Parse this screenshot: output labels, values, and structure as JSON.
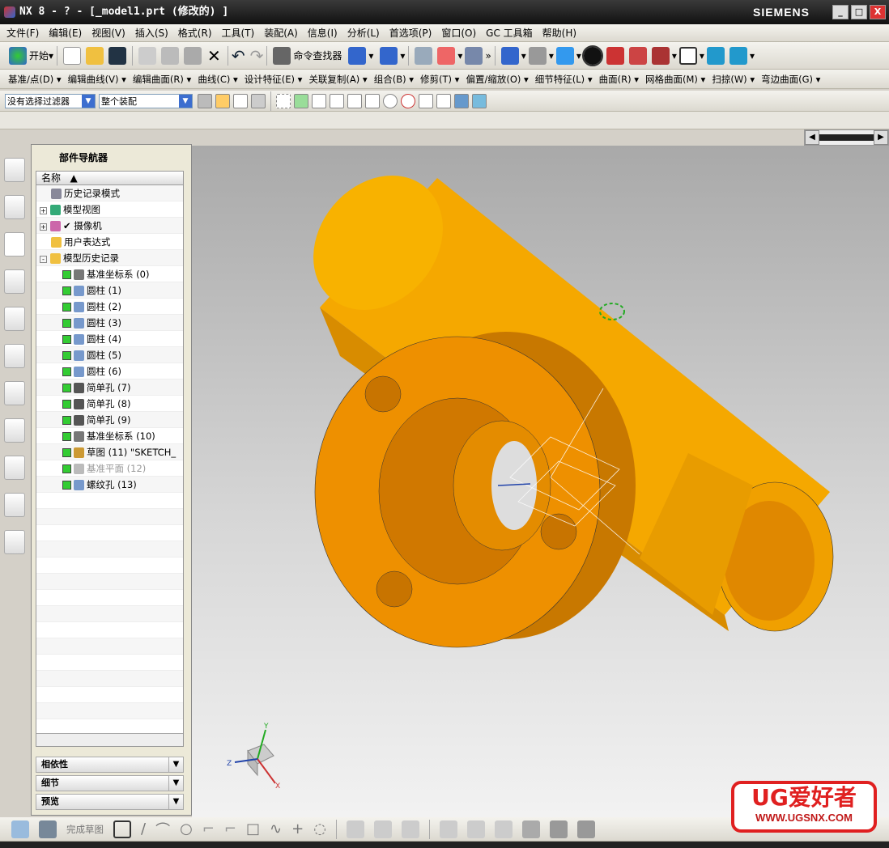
{
  "window": {
    "title": "NX 8 - ? - [_model1.prt (修改的) ]",
    "brand": "SIEMENS",
    "min": "_",
    "max": "□",
    "close": "X"
  },
  "menu": [
    "文件(F)",
    "编辑(E)",
    "视图(V)",
    "插入(S)",
    "格式(R)",
    "工具(T)",
    "装配(A)",
    "信息(I)",
    "分析(L)",
    "首选项(P)",
    "窗口(O)",
    "GC 工具箱",
    "帮助(H)"
  ],
  "toolbar": {
    "start": "开始",
    "command_finder": "命令查找器"
  },
  "feature_toolbar": [
    "基准/点(D) ▾",
    "编辑曲线(V) ▾",
    "编辑曲面(R) ▾",
    "曲线(C) ▾",
    "设计特征(E) ▾",
    "关联复制(A) ▾",
    "组合(B) ▾",
    "修剪(T) ▾",
    "偏置/缩放(O) ▾",
    "细节特征(L) ▾",
    "曲面(R) ▾",
    "网格曲面(M) ▾",
    "扫掠(W) ▾",
    "弯边曲面(G) ▾"
  ],
  "selection": {
    "filter": "没有选择过滤器",
    "scope": "整个装配"
  },
  "navigator": {
    "title": "部件导航器",
    "column": "名称",
    "items": [
      {
        "label": "历史记录模式",
        "indent": 1,
        "type": "clock"
      },
      {
        "label": "模型视图",
        "indent": 0,
        "type": "view",
        "expander": "+"
      },
      {
        "label": "✔ 摄像机",
        "indent": 0,
        "type": "camera",
        "expander": "+"
      },
      {
        "label": "用户表达式",
        "indent": 1,
        "type": "folder"
      },
      {
        "label": "模型历史记录",
        "indent": 0,
        "type": "folder",
        "expander": "-"
      },
      {
        "label": "基准坐标系 (0)",
        "indent": 2,
        "type": "csys",
        "checked": true
      },
      {
        "label": "圆柱 (1)",
        "indent": 2,
        "type": "cyl",
        "checked": true
      },
      {
        "label": "圆柱 (2)",
        "indent": 2,
        "type": "cyl",
        "checked": true
      },
      {
        "label": "圆柱 (3)",
        "indent": 2,
        "type": "cyl",
        "checked": true
      },
      {
        "label": "圆柱 (4)",
        "indent": 2,
        "type": "cyl",
        "checked": true
      },
      {
        "label": "圆柱 (5)",
        "indent": 2,
        "type": "cyl",
        "checked": true
      },
      {
        "label": "圆柱 (6)",
        "indent": 2,
        "type": "cyl",
        "checked": true
      },
      {
        "label": "简单孔 (7)",
        "indent": 2,
        "type": "hole",
        "checked": true
      },
      {
        "label": "简单孔 (8)",
        "indent": 2,
        "type": "hole",
        "checked": true
      },
      {
        "label": "简单孔 (9)",
        "indent": 2,
        "type": "hole",
        "checked": true
      },
      {
        "label": "基准坐标系 (10)",
        "indent": 2,
        "type": "csys",
        "checked": true
      },
      {
        "label": "草图 (11) \"SKETCH_",
        "indent": 2,
        "type": "sketch",
        "checked": true
      },
      {
        "label": "基准平面 (12)",
        "indent": 2,
        "type": "plane",
        "checked": true,
        "dimmed": true
      },
      {
        "label": "螺纹孔 (13)",
        "indent": 2,
        "type": "thread",
        "checked": true
      }
    ],
    "panels": [
      "相依性",
      "细节",
      "预览"
    ]
  },
  "bottom_toolbar": {
    "finish_sketch": "完成草图"
  },
  "watermark": {
    "line1": "UG爱好者",
    "line2": "WWW.UGSNX.COM"
  },
  "colors": {
    "model": "#f5a800",
    "model_face": "#ec8e00",
    "watermark": "#e02020"
  }
}
